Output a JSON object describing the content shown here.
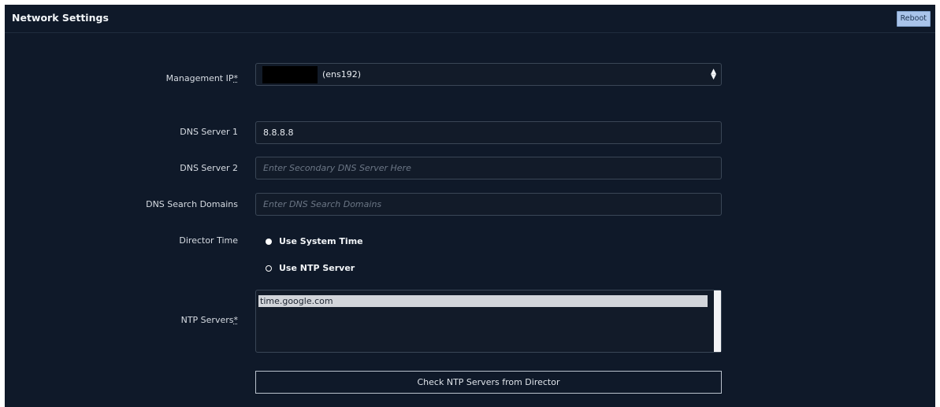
{
  "header": {
    "title": "Network Settings",
    "reboot_label": "Reboot"
  },
  "management_ip": {
    "label": "Management IP",
    "required_mark": "*",
    "interface": "(ens192)",
    "select_icon": "up-down-arrows-icon"
  },
  "dns1": {
    "label": "DNS Server 1",
    "value": "8.8.8.8"
  },
  "dns2": {
    "label": "DNS Server 2",
    "placeholder": "Enter Secondary DNS Server Here"
  },
  "dns_search": {
    "label": "DNS Search Domains",
    "placeholder": "Enter DNS Search Domains"
  },
  "director_time": {
    "label": "Director Time",
    "options": [
      {
        "label": "Use System Time",
        "selected": true
      },
      {
        "label": "Use NTP Server",
        "selected": false
      }
    ]
  },
  "ntp": {
    "label": "NTP Servers",
    "required_mark": "*",
    "entries": [
      "time.google.com"
    ]
  },
  "check_button_label": "Check NTP Servers from Director",
  "colors": {
    "panel_bg": "#0f1929",
    "reboot_bg": "#a9c4ea"
  }
}
